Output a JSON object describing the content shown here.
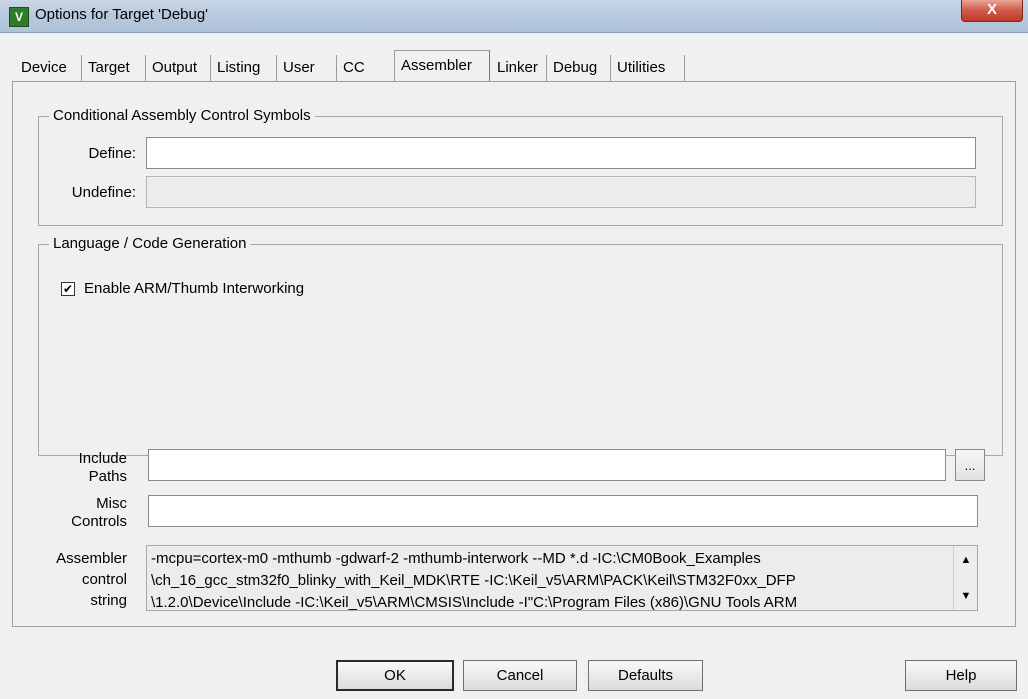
{
  "window": {
    "title": "Options for Target 'Debug'",
    "app_icon": "V",
    "close_label": "X"
  },
  "tabs": [
    {
      "label": "Device"
    },
    {
      "label": "Target"
    },
    {
      "label": "Output"
    },
    {
      "label": "Listing"
    },
    {
      "label": "User"
    },
    {
      "label": "CC"
    },
    {
      "label": "Assembler",
      "active": true
    },
    {
      "label": "Linker"
    },
    {
      "label": "Debug"
    },
    {
      "label": "Utilities"
    }
  ],
  "conditional": {
    "title": "Conditional Assembly Control Symbols",
    "define_label": "Define:",
    "define_value": "",
    "undefine_label": "Undefine:",
    "undefine_value": ""
  },
  "language": {
    "title": "Language / Code Generation",
    "interworking_label": "Enable ARM/Thumb Interworking",
    "interworking_checked": true,
    "check_glyph": "✔"
  },
  "include_paths": {
    "label_line1": "Include",
    "label_line2": "Paths",
    "value": "",
    "browse_label": "..."
  },
  "misc_controls": {
    "label_line1": "Misc",
    "label_line2": "Controls",
    "value": ""
  },
  "control_string": {
    "label_line1": "Assembler",
    "label_line2": "control",
    "label_line3": "string",
    "lines": [
      "-mcpu=cortex-m0 -mthumb -gdwarf-2 -mthumb-interwork --MD *.d -IC:\\CM0Book_Examples",
      "\\ch_16_gcc_stm32f0_blinky_with_Keil_MDK\\RTE -IC:\\Keil_v5\\ARM\\PACK\\Keil\\STM32F0xx_DFP",
      "\\1.2.0\\Device\\Include -IC:\\Keil_v5\\ARM\\CMSIS\\Include -I\"C:\\Program Files (x86)\\GNU Tools ARM"
    ],
    "scroll_up": "▲",
    "scroll_down": "▼"
  },
  "buttons": {
    "ok": "OK",
    "cancel": "Cancel",
    "defaults": "Defaults",
    "help": "Help"
  }
}
